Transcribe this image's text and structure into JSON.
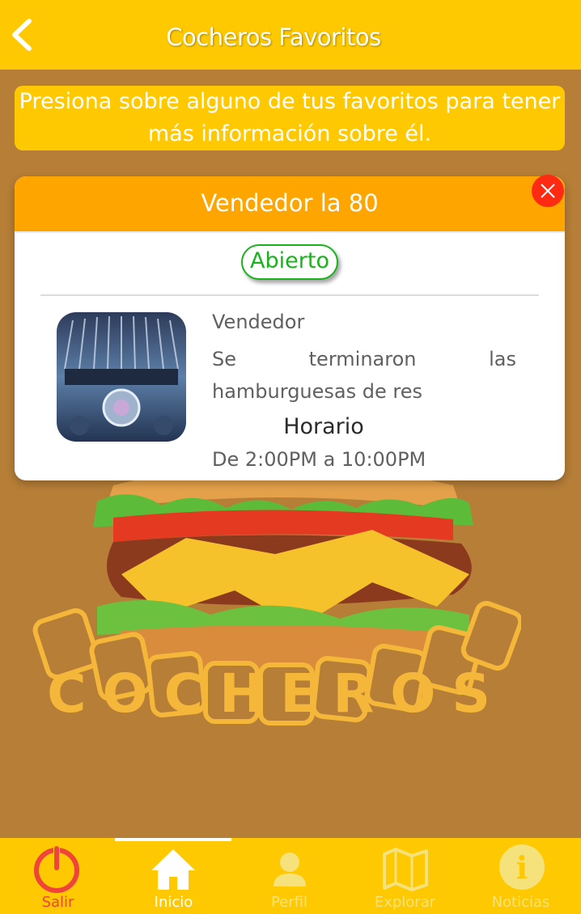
{
  "header": {
    "title": "Cocheros Favoritos",
    "back_icon": "chevron-left-icon"
  },
  "banner": {
    "text": "Presiona sobre alguno de tus favoritos para tener más información sobre él."
  },
  "background": {
    "logo_text": "COCHEROS"
  },
  "card": {
    "title": "Vendedor la 80",
    "close_icon": "close-icon",
    "status": "Abierto",
    "type": "Vendedor",
    "description": "Se terminaron las hamburguesas de res",
    "schedule_title": "Horario",
    "schedule_hours": "De 2:00PM a 10:00PM"
  },
  "nav": {
    "items": [
      {
        "label": "Salir",
        "icon": "power-icon",
        "color": "#f0433a"
      },
      {
        "label": "Inicio",
        "icon": "home-icon",
        "color": "#ffffff",
        "active": true
      },
      {
        "label": "Perfil",
        "icon": "user-icon",
        "color": "#f5e27a"
      },
      {
        "label": "Explorar",
        "icon": "map-icon",
        "color": "#f5e27a"
      },
      {
        "label": "Noticias",
        "icon": "info-icon",
        "color": "#f5e27a"
      }
    ]
  },
  "colors": {
    "primary_yellow": "#fec901",
    "header_orange": "#ffa500",
    "background_brown": "#b67e37",
    "open_green": "#19b31b",
    "close_red": "#ff2a12"
  }
}
